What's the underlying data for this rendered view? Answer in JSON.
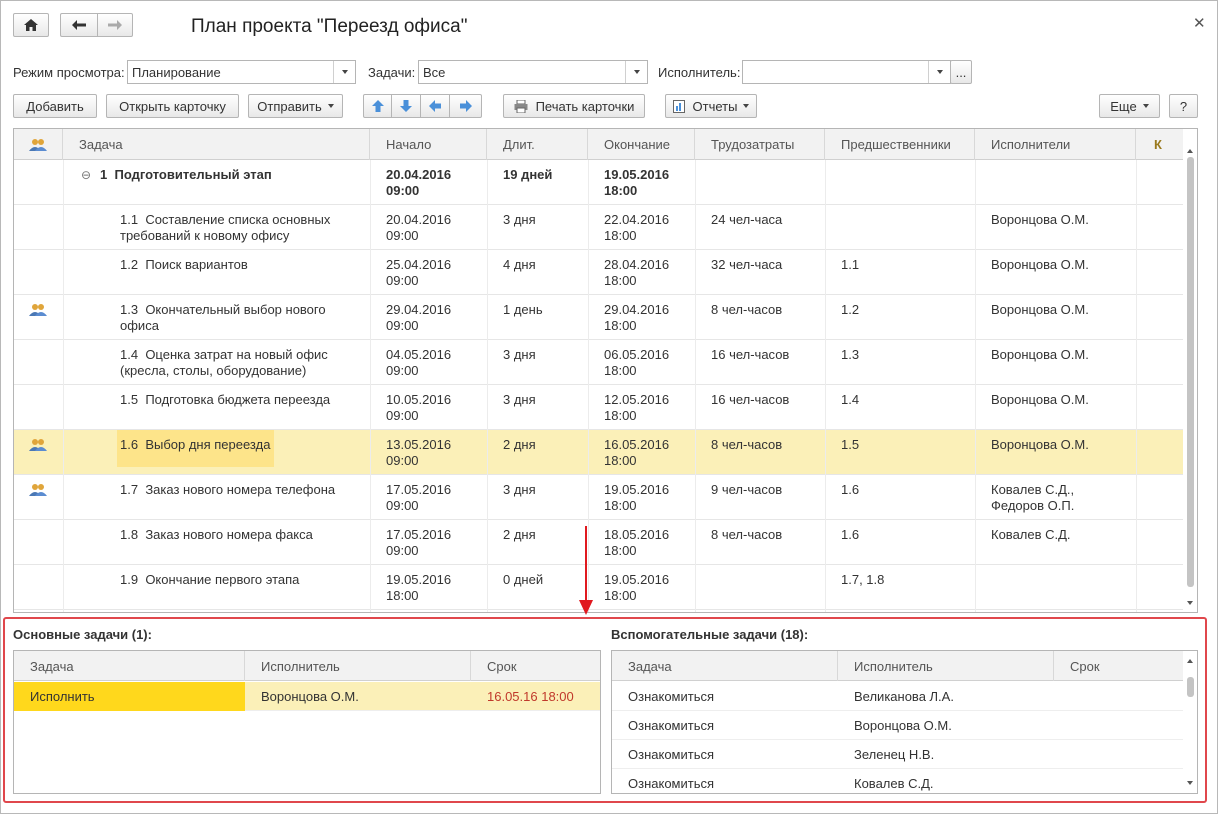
{
  "window": {
    "title": "План проекта \"Переезд офиса\""
  },
  "filters": {
    "mode_label": "Режим просмотра:",
    "mode_value": "Планирование",
    "tasks_label": "Задачи:",
    "tasks_value": "Все",
    "executor_label": "Исполнитель:",
    "executor_value": "",
    "executor_more": "..."
  },
  "toolbar": {
    "add": "Добавить",
    "open_card": "Открыть карточку",
    "send": "Отправить",
    "print_cards": "Печать карточки",
    "reports": "Отчеты",
    "more": "Еще",
    "help": "?"
  },
  "columns": {
    "task": "Задача",
    "start": "Начало",
    "duration": "Длит.",
    "end": "Окончание",
    "effort": "Трудозатраты",
    "predecessors": "Предшественники",
    "executors": "Исполнители",
    "k": "К"
  },
  "rows": [
    {
      "num": "1",
      "name": "Подготовительный этап",
      "start": [
        "20.04.2016",
        "09:00"
      ],
      "duration": "19 дней",
      "end": [
        "19.05.2016",
        "18:00"
      ],
      "effort": "",
      "pred": "",
      "exec": [
        "",
        ""
      ],
      "icon": false,
      "group": true,
      "selected": false
    },
    {
      "num": "1.1",
      "name": "Составление списка основных",
      "name2": "требований к новому офису",
      "start": [
        "20.04.2016",
        "09:00"
      ],
      "duration": "3 дня",
      "end": [
        "22.04.2016",
        "18:00"
      ],
      "effort": "24 чел-часа",
      "pred": "",
      "exec": [
        "Воронцова О.М.",
        ""
      ],
      "icon": false,
      "group": false,
      "selected": false
    },
    {
      "num": "1.2",
      "name": "Поиск вариантов",
      "start": [
        "25.04.2016",
        "09:00"
      ],
      "duration": "4 дня",
      "end": [
        "28.04.2016",
        "18:00"
      ],
      "effort": "32 чел-часа",
      "pred": "1.1",
      "exec": [
        "Воронцова О.М.",
        ""
      ],
      "icon": false,
      "group": false,
      "selected": false
    },
    {
      "num": "1.3",
      "name": "Окончательный выбор нового офиса",
      "start": [
        "29.04.2016",
        "09:00"
      ],
      "duration": "1 день",
      "end": [
        "29.04.2016",
        "18:00"
      ],
      "effort": "8 чел-часов",
      "pred": "1.2",
      "exec": [
        "Воронцова О.М.",
        ""
      ],
      "icon": true,
      "group": false,
      "selected": false
    },
    {
      "num": "1.4",
      "name": "Оценка затрат на новый офис",
      "name2": "(кресла, столы, оборудование)",
      "start": [
        "04.05.2016",
        "09:00"
      ],
      "duration": "3 дня",
      "end": [
        "06.05.2016",
        "18:00"
      ],
      "effort": "16 чел-часов",
      "pred": "1.3",
      "exec": [
        "Воронцова О.М.",
        ""
      ],
      "icon": false,
      "group": false,
      "selected": false
    },
    {
      "num": "1.5",
      "name": "Подготовка бюджета переезда",
      "start": [
        "10.05.2016",
        "09:00"
      ],
      "duration": "3 дня",
      "end": [
        "12.05.2016",
        "18:00"
      ],
      "effort": "16 чел-часов",
      "pred": "1.4",
      "exec": [
        "Воронцова О.М.",
        ""
      ],
      "icon": false,
      "group": false,
      "selected": false
    },
    {
      "num": "1.6",
      "name": "Выбор дня переезда",
      "start": [
        "13.05.2016",
        "09:00"
      ],
      "duration": "2 дня",
      "end": [
        "16.05.2016",
        "18:00"
      ],
      "effort": "8 чел-часов",
      "pred": "1.5",
      "exec": [
        "Воронцова О.М.",
        ""
      ],
      "icon": true,
      "group": false,
      "selected": true
    },
    {
      "num": "1.7",
      "name": "Заказ нового номера телефона",
      "start": [
        "17.05.2016",
        "09:00"
      ],
      "duration": "3 дня",
      "end": [
        "19.05.2016",
        "18:00"
      ],
      "effort": "9 чел-часов",
      "pred": "1.6",
      "exec": [
        "Ковалев С.Д.,",
        "Федоров О.П."
      ],
      "icon": true,
      "group": false,
      "selected": false
    },
    {
      "num": "1.8",
      "name": "Заказ нового номера факса",
      "start": [
        "17.05.2016",
        "09:00"
      ],
      "duration": "2 дня",
      "end": [
        "18.05.2016",
        "18:00"
      ],
      "effort": "8 чел-часов",
      "pred": "1.6",
      "exec": [
        "Ковалев С.Д.",
        ""
      ],
      "icon": false,
      "group": false,
      "selected": false
    },
    {
      "num": "1.9",
      "name": "Окончание первого этапа",
      "start": [
        "19.05.2016",
        "18:00"
      ],
      "duration": "0 дней",
      "end": [
        "19.05.2016",
        "18:00"
      ],
      "effort": "",
      "pred": "1.7, 1.8",
      "exec": [
        "",
        ""
      ],
      "icon": false,
      "group": false,
      "selected": false
    }
  ],
  "main_tasks": {
    "title": "Основные задачи (1):",
    "columns": {
      "task": "Задача",
      "executor": "Исполнитель",
      "deadline": "Срок"
    },
    "rows": [
      {
        "task": "Исполнить",
        "executor": "Воронцова О.М.",
        "deadline": "16.05.16 18:00"
      }
    ]
  },
  "aux_tasks": {
    "title": "Вспомогательные задачи (18):",
    "columns": {
      "task": "Задача",
      "executor": "Исполнитель",
      "deadline": "Срок"
    },
    "rows": [
      {
        "task": "Ознакомиться",
        "executor": "Великанова Л.А.",
        "deadline": ""
      },
      {
        "task": "Ознакомиться",
        "executor": "Воронцова О.М.",
        "deadline": ""
      },
      {
        "task": "Ознакомиться",
        "executor": "Зеленец Н.В.",
        "deadline": ""
      },
      {
        "task": "Ознакомиться",
        "executor": "Ковалев С.Д.",
        "deadline": ""
      }
    ]
  },
  "colors": {
    "selection": "#fbf0b8",
    "selection_strong": "#ffd81c",
    "deadline": "#c0392b",
    "highlight_frame": "#e0474c",
    "arrow": "#e0191f"
  },
  "icons": {
    "home": "home-icon",
    "back": "arrow-left-icon",
    "forward": "arrow-right-icon",
    "close": "close-icon",
    "people": "people-icon",
    "print": "printer-icon",
    "reports": "report-icon"
  }
}
